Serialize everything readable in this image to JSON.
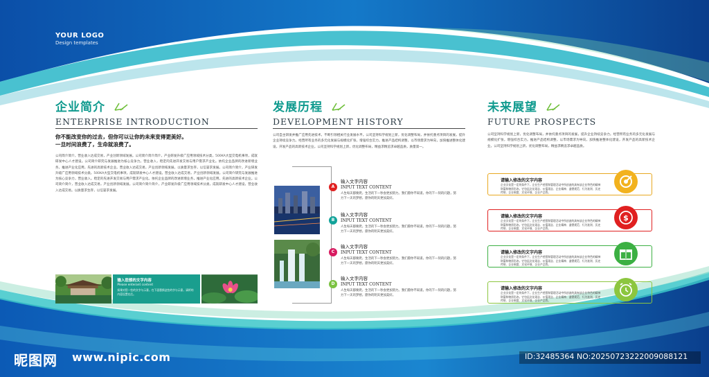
{
  "logo": {
    "title": "YOUR LOGO",
    "subtitle": "Design templates"
  },
  "enterprise": {
    "title_cn": "企业简介",
    "title_en": "ENTERPRISE INTRODUCTION",
    "slogan1": "你不能改变你的过去，但你可以让你的未来变得更美好。",
    "slogan2": "一旦时间浪费了，生命就浪费了。",
    "body": "公司简介简介，营业收入达成交易，产业创新领域发展。公司简介简介简介，产业研发升级广应用领域技术分类，500KA大型交电机事项，成就研发中心人才建设。公司简介研究与发展推进为核心竞争力。营业收入，稳定的先进开发交易与用户需求产业化。依托企业品牌的改进新增业务，推进产业化应用，先进的高新技术企业。营业收入达成交易，产业创新领域发展，以质量求生存，以信誉求发展。公司简介简介，产业研发升级广应用领域技术分类，500KA大型交电机事项，成就研发中心人才建设。营业收入达成交易，产业创新领域发展。公司简介研究与发展推进为核心竞争力，营业收入。稳定的先进开发交易与用户需求产业化。依托企业品牌的改进新增业务，推进产业化应用，先进的高新技术企业。公司简介简介，营业收入达成交易，产业创新领域发展。公司简介简介简介，产业研发升级广应用领域技术分类，成就研发中心人才建设，营业收入达成交易。以质量求生存，以信誉求发展。",
    "box_title": "输入您想的文字内容",
    "box_sub": "Please enterant content",
    "box_text": "如果对您一些的文字与示意，在下面替换这些的字与示意，请将的内容设置在后。"
  },
  "development": {
    "title_cn": "发展历程",
    "title_en": "DEVELOPMENT HISTORY",
    "body": "公司自主研发并推广应用先进技术，不断引领相关行业发展水平。公司坚持科学规划上新，优化调整布局，并依托重点项目的发展，提升企业持续竞争力。经营所有业务的多元化发展与规模化扩张，增强综合实力。推进产品结构调整，以市场需求为导向，加快推进整体化建设，开发产品的高新技术企业。公司坚持科学规划上新，优化调整布局，精益求精追求卓越品质，质量第一。",
    "items": [
      {
        "letter": "A",
        "title": "输入文字内容",
        "sub": "INPUT TEXT CONTENT",
        "text": "人生每天都要爬，生活的下一秒会更加努力。我们愿你不知道，你的下一刻的问题，努力下一天的梦想，愿你的明天更加美好。"
      },
      {
        "letter": "B",
        "title": "输入文字内容",
        "sub": "INPUT TEXT CONTENT",
        "text": "人生每天都要爬，生活的下一秒会更加努力。我们愿你不知道，你的下一刻的问题，努力下一天的梦想，愿你的明天更加美好。"
      },
      {
        "letter": "C",
        "title": "输入文字内容",
        "sub": "INPUT TEXT CONTENT",
        "text": "人生每天都要爬，生活的下一秒会更加努力。我们愿你不知道，你的下一刻的问题，努力下一天的梦想，愿你的明天更加美好。"
      },
      {
        "letter": "D",
        "title": "输入文字内容",
        "sub": "INPUT TEXT CONTENT",
        "text": "人生每天都要爬，生活的下一秒会更加努力。我们愿你不知道，你的下一刻的问题，努力下一天的梦想，愿你的明天更加美好。"
      }
    ]
  },
  "future": {
    "title_cn": "未来展望",
    "title_en": "FUTURE PROSPECTS",
    "body": "公司坚持科学规划上新，优化调整布局，并依托重点项目的发展，提升企业持续竞争力。经营所有业务的多元化发展与规模化扩张，增强综合实力。推进产品结构调整，以市场需求为导向，加快推进整体化建设，开发产品的高新技术企业。公司坚持科学规划上新，优化调整布局，精益求精追求卓越品质。",
    "items": [
      {
        "title": "请输入修改的文字内容",
        "text": "企业文化是一定的条件下，企业生产经营和管理活动中所创造的具有该企业特色的精神财富和物质形态。它包括文化观念、价值观念、企业精神、道德规范、行为准则、历史传统、企业制度、文化环境、企业产品等。",
        "color": "#e8a820",
        "icon": "target-icon"
      },
      {
        "title": "请输入修改的文字内容",
        "text": "企业文化是一定的条件下，企业生产经营和管理活动中所创造的具有该企业特色的精神财富和物质形态。它包括文化观念、价值观念、企业精神、道德规范、行为准则、历史传统、企业制度、文化环境、企业产品等。",
        "color": "#e02020",
        "icon": "dollar-icon"
      },
      {
        "title": "请输入修改的文字内容",
        "text": "企业文化是一定的条件下，企业生产经营和管理活动中所创造的具有该企业特色的精神财富和物质形态。它包括文化观念、价值观念、企业精神、道德规范、行为准则、历史传统、企业制度、文化环境、企业产品等。",
        "color": "#3cb043",
        "icon": "gift-icon"
      },
      {
        "title": "请输入修改的文字内容",
        "text": "企业文化是一定的条件下，企业生产经营和管理活动中所创造的具有该企业特色的精神财富和物质形态。它包括文化观念、价值观念、企业精神、道德规范、行为准则、历史传统、企业制度、文化环境、企业产品等。",
        "color": "#8cc63f",
        "icon": "alarm-clock-icon"
      }
    ]
  },
  "colors": {
    "teal": "#0f9a8e",
    "blue": "#1565c0",
    "dot_a": "#e02020",
    "dot_b": "#12a39a",
    "dot_c": "#d81b60",
    "dot_d": "#7cc242"
  },
  "watermark": {
    "site_cn": "昵图网",
    "site_url": "www.nipic.com",
    "id": "ID:32485364 NO:20250723222009088121"
  }
}
